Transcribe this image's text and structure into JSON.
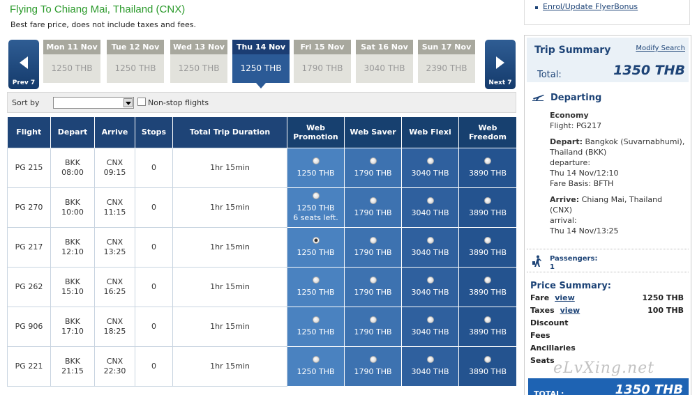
{
  "header": {
    "title": "Flying To Chiang Mai, Thailand (CNX)",
    "subtitle": "Best fare price, does not include taxes and fees."
  },
  "carousel": {
    "prev_label": "Prev 7",
    "next_label": "Next 7",
    "days": [
      {
        "label": "Mon 11 Nov",
        "price": "1250 THB"
      },
      {
        "label": "Tue 12 Nov",
        "price": "1250 THB"
      },
      {
        "label": "Wed 13 Nov",
        "price": "1250 THB"
      },
      {
        "label": "Thu 14 Nov",
        "price": "1250 THB"
      },
      {
        "label": "Fri 15 Nov",
        "price": "1790 THB"
      },
      {
        "label": "Sat 16 Nov",
        "price": "3040 THB"
      },
      {
        "label": "Sun 17 Nov",
        "price": "2390 THB"
      }
    ],
    "selected_index": 3
  },
  "sortbar": {
    "sort_label": "Sort by",
    "nonstop_label": "Non-stop flights"
  },
  "table": {
    "headers": {
      "flight": "Flight",
      "depart": "Depart",
      "arrive": "Arrive",
      "stops": "Stops",
      "duration": "Total Trip Duration",
      "promo": "Web Promotion",
      "saver": "Web Saver",
      "flexi": "Web Flexi",
      "freedom": "Web Freedom"
    },
    "rows": [
      {
        "flight": "PG 215",
        "dep_code": "BKK",
        "dep_time": "08:00",
        "arr_code": "CNX",
        "arr_time": "09:15",
        "stops": "0",
        "duration": "1hr 15min",
        "promo": "1250 THB",
        "promo_note": "",
        "saver": "1790 THB",
        "flexi": "3040 THB",
        "freedom": "3890 THB"
      },
      {
        "flight": "PG 270",
        "dep_code": "BKK",
        "dep_time": "10:00",
        "arr_code": "CNX",
        "arr_time": "11:15",
        "stops": "0",
        "duration": "1hr 15min",
        "promo": "1250 THB",
        "promo_note": "6 seats left.",
        "saver": "1790 THB",
        "flexi": "3040 THB",
        "freedom": "3890 THB"
      },
      {
        "flight": "PG 217",
        "dep_code": "BKK",
        "dep_time": "12:10",
        "arr_code": "CNX",
        "arr_time": "13:25",
        "stops": "0",
        "duration": "1hr 15min",
        "promo": "1250 THB",
        "promo_note": "",
        "saver": "1790 THB",
        "flexi": "3040 THB",
        "freedom": "3890 THB"
      },
      {
        "flight": "PG 262",
        "dep_code": "BKK",
        "dep_time": "15:10",
        "arr_code": "CNX",
        "arr_time": "16:25",
        "stops": "0",
        "duration": "1hr 15min",
        "promo": "1250 THB",
        "promo_note": "",
        "saver": "1790 THB",
        "flexi": "3040 THB",
        "freedom": "3890 THB"
      },
      {
        "flight": "PG 906",
        "dep_code": "BKK",
        "dep_time": "17:10",
        "arr_code": "CNX",
        "arr_time": "18:25",
        "stops": "0",
        "duration": "1hr 15min",
        "promo": "1250 THB",
        "promo_note": "",
        "saver": "1790 THB",
        "flexi": "3040 THB",
        "freedom": "3890 THB"
      },
      {
        "flight": "PG 221",
        "dep_code": "BKK",
        "dep_time": "21:15",
        "arr_code": "CNX",
        "arr_time": "22:30",
        "stops": "0",
        "duration": "1hr 15min",
        "promo": "1250 THB",
        "promo_note": "",
        "saver": "1790 THB",
        "flexi": "3040 THB",
        "freedom": "3890 THB"
      }
    ],
    "selected_row": 2
  },
  "sidebar": {
    "flyerbonus_link": "Enrol/Update FlyerBonus",
    "summary_title": "Trip Summary",
    "modify_link": "Modify Search",
    "total_label": "Total:",
    "total_amount": "1350 THB",
    "departing_title": "Departing",
    "cabin": "Economy",
    "flight_line": "Flight: PG217",
    "depart_label": "Depart:",
    "depart_place": "Bangkok (Suvarnabhumi), Thailand (BKK)",
    "departure_label": "departure:",
    "departure_time": "Thu 14 Nov/12:10",
    "fare_basis": "Fare Basis: BFTH",
    "arrive_label": "Arrive:",
    "arrive_place": "Chiang Mai, Thailand (CNX)",
    "arrival_label": "arrival:",
    "arrival_time": "Thu 14 Nov/13:25",
    "passengers_label": "Passengers:",
    "passengers_count": "1",
    "price_title": "Price Summary:",
    "fare_label": "Fare",
    "fare_view": "view",
    "fare_amount": "1250 THB",
    "taxes_label": "Taxes",
    "taxes_view": "view",
    "taxes_amount": "100 THB",
    "discount_label": "Discount",
    "fees_label": "Fees",
    "ancillaries_label": "Ancillaries",
    "seats_label": "Seats",
    "total_bar_label": "TOTAL:",
    "total_bar_amount": "1350 THB"
  },
  "watermark": "eLvXing.net",
  "icons": [
    "chevron-left-icon",
    "chevron-right-icon",
    "airplane-icon",
    "walker-icon"
  ],
  "colors": {
    "title_green": "#2b9a2b",
    "navy": "#1e4477",
    "selected_day": "#2b5a96",
    "total_bar": "#1e63b3"
  }
}
